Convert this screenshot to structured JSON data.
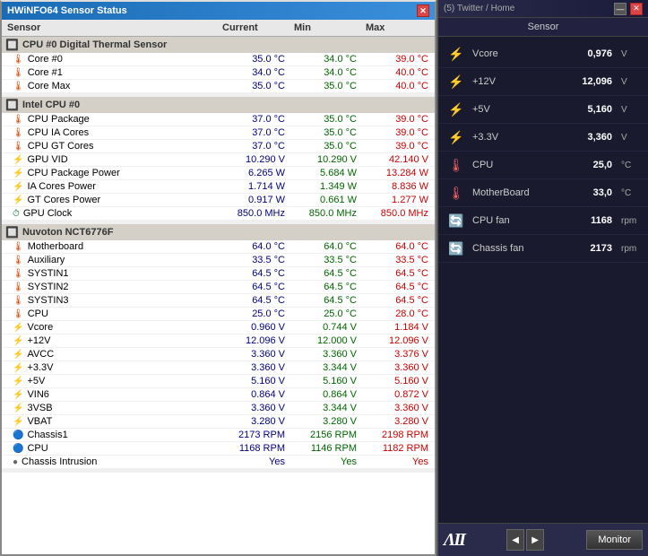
{
  "hwinfo": {
    "title": "HWiNFO64 Sensor Status",
    "columns": {
      "sensor": "Sensor",
      "current": "Current",
      "min": "Min",
      "max": "Max"
    },
    "sections": [
      {
        "id": "cpu-thermal",
        "name": "CPU #0 Digital Thermal Sensor",
        "icon": "cpu-icon",
        "rows": [
          {
            "name": "Core #0",
            "current": "35.0 °C",
            "min": "34.0 °C",
            "max": "39.0 °C",
            "type": "temp"
          },
          {
            "name": "Core #1",
            "current": "34.0 °C",
            "min": "34.0 °C",
            "max": "40.0 °C",
            "type": "temp"
          },
          {
            "name": "Core Max",
            "current": "35.0 °C",
            "min": "35.0 °C",
            "max": "40.0 °C",
            "type": "temp"
          }
        ]
      },
      {
        "id": "intel-cpu",
        "name": "Intel CPU #0",
        "icon": "cpu-icon",
        "rows": [
          {
            "name": "CPU Package",
            "current": "37.0 °C",
            "min": "35.0 °C",
            "max": "39.0 °C",
            "type": "temp"
          },
          {
            "name": "CPU IA Cores",
            "current": "37.0 °C",
            "min": "35.0 °C",
            "max": "39.0 °C",
            "type": "temp"
          },
          {
            "name": "CPU GT Cores",
            "current": "37.0 °C",
            "min": "35.0 °C",
            "max": "39.0 °C",
            "type": "temp"
          },
          {
            "name": "GPU VID",
            "current": "10.290 V",
            "min": "10.290 V",
            "max": "42.140 V",
            "type": "volt"
          },
          {
            "name": "CPU Package Power",
            "current": "6.265 W",
            "min": "5.684 W",
            "max": "13.284 W",
            "type": "power"
          },
          {
            "name": "IA Cores Power",
            "current": "1.714 W",
            "min": "1.349 W",
            "max": "8.836 W",
            "type": "power"
          },
          {
            "name": "GT Cores Power",
            "current": "0.917 W",
            "min": "0.661 W",
            "max": "1.277 W",
            "type": "power"
          },
          {
            "name": "GPU Clock",
            "current": "850.0 MHz",
            "min": "850.0 MHz",
            "max": "850.0 MHz",
            "type": "clock"
          }
        ]
      },
      {
        "id": "nuvoton",
        "name": "Nuvoton NCT6776F",
        "icon": "motherboard-icon",
        "rows": [
          {
            "name": "Motherboard",
            "current": "64.0 °C",
            "min": "64.0 °C",
            "max": "64.0 °C",
            "type": "temp"
          },
          {
            "name": "Auxiliary",
            "current": "33.5 °C",
            "min": "33.5 °C",
            "max": "33.5 °C",
            "type": "temp"
          },
          {
            "name": "SYSTIN1",
            "current": "64.5 °C",
            "min": "64.5 °C",
            "max": "64.5 °C",
            "type": "temp"
          },
          {
            "name": "SYSTIN2",
            "current": "64.5 °C",
            "min": "64.5 °C",
            "max": "64.5 °C",
            "type": "temp"
          },
          {
            "name": "SYSTIN3",
            "current": "64.5 °C",
            "min": "64.5 °C",
            "max": "64.5 °C",
            "type": "temp"
          },
          {
            "name": "CPU",
            "current": "25.0 °C",
            "min": "25.0 °C",
            "max": "28.0 °C",
            "type": "temp"
          },
          {
            "name": "Vcore",
            "current": "0.960 V",
            "min": "0.744 V",
            "max": "1.184 V",
            "type": "volt"
          },
          {
            "name": "+12V",
            "current": "12.096 V",
            "min": "12.000 V",
            "max": "12.096 V",
            "type": "volt"
          },
          {
            "name": "AVCC",
            "current": "3.360 V",
            "min": "3.360 V",
            "max": "3.376 V",
            "type": "volt"
          },
          {
            "name": "+3.3V",
            "current": "3.360 V",
            "min": "3.344 V",
            "max": "3.360 V",
            "type": "volt"
          },
          {
            "name": "+5V",
            "current": "5.160 V",
            "min": "5.160 V",
            "max": "5.160 V",
            "type": "volt"
          },
          {
            "name": "VIN6",
            "current": "0.864 V",
            "min": "0.864 V",
            "max": "0.872 V",
            "type": "volt"
          },
          {
            "name": "3VSB",
            "current": "3.360 V",
            "min": "3.344 V",
            "max": "3.360 V",
            "type": "volt"
          },
          {
            "name": "VBAT",
            "current": "3.280 V",
            "min": "3.280 V",
            "max": "3.280 V",
            "type": "volt"
          },
          {
            "name": "Chassis1",
            "current": "2173 RPM",
            "min": "2156 RPM",
            "max": "2198 RPM",
            "type": "fan"
          },
          {
            "name": "CPU",
            "current": "1168 RPM",
            "min": "1146 RPM",
            "max": "1182 RPM",
            "type": "fan"
          },
          {
            "name": "Chassis Intrusion",
            "current": "Yes",
            "min": "Yes",
            "max": "Yes",
            "type": "bool"
          }
        ]
      }
    ]
  },
  "aisuite": {
    "title": "(5) Twitter / Home",
    "window_controls": {
      "minimize": "—",
      "close": "✕"
    },
    "header": "Sensor",
    "rows": [
      {
        "name": "Vcore",
        "value": "0,976",
        "unit": "V",
        "type": "volt"
      },
      {
        "name": "+12V",
        "value": "12,096",
        "unit": "V",
        "type": "volt"
      },
      {
        "name": "+5V",
        "value": "5,160",
        "unit": "V",
        "type": "volt"
      },
      {
        "name": "+3.3V",
        "value": "3,360",
        "unit": "V",
        "type": "volt"
      },
      {
        "name": "CPU",
        "value": "25,0",
        "unit": "°C",
        "type": "temp"
      },
      {
        "name": "MotherBoard",
        "value": "33,0",
        "unit": "°C",
        "type": "temp"
      },
      {
        "name": "CPU fan",
        "value": "1168",
        "unit": "rpm",
        "type": "fan"
      },
      {
        "name": "Chassis fan",
        "value": "2173",
        "unit": "rpm",
        "type": "fan"
      }
    ],
    "logo": "ΛII",
    "monitor_label": "Monitor"
  }
}
